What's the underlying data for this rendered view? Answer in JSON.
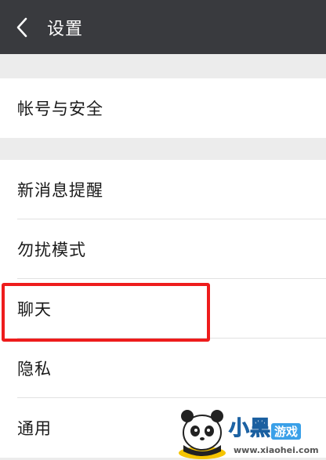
{
  "header": {
    "title": "设置",
    "back_icon": "chevron-left-icon"
  },
  "sections": {
    "account": {
      "items": [
        {
          "label": "帐号与安全"
        }
      ]
    },
    "general": {
      "items": [
        {
          "label": "新消息提醒"
        },
        {
          "label": "勿扰模式"
        },
        {
          "label": "聊天"
        },
        {
          "label": "隐私"
        },
        {
          "label": "通用"
        }
      ]
    }
  },
  "highlight": {
    "target": "聊天",
    "color": "#ee1c1c"
  },
  "watermark": {
    "brand": "小黑",
    "sub": "游戏",
    "url": "www.xiaohei.com"
  },
  "colors": {
    "header_bg": "#393a3e",
    "page_bg": "#ececec",
    "row_bg": "#ffffff"
  }
}
